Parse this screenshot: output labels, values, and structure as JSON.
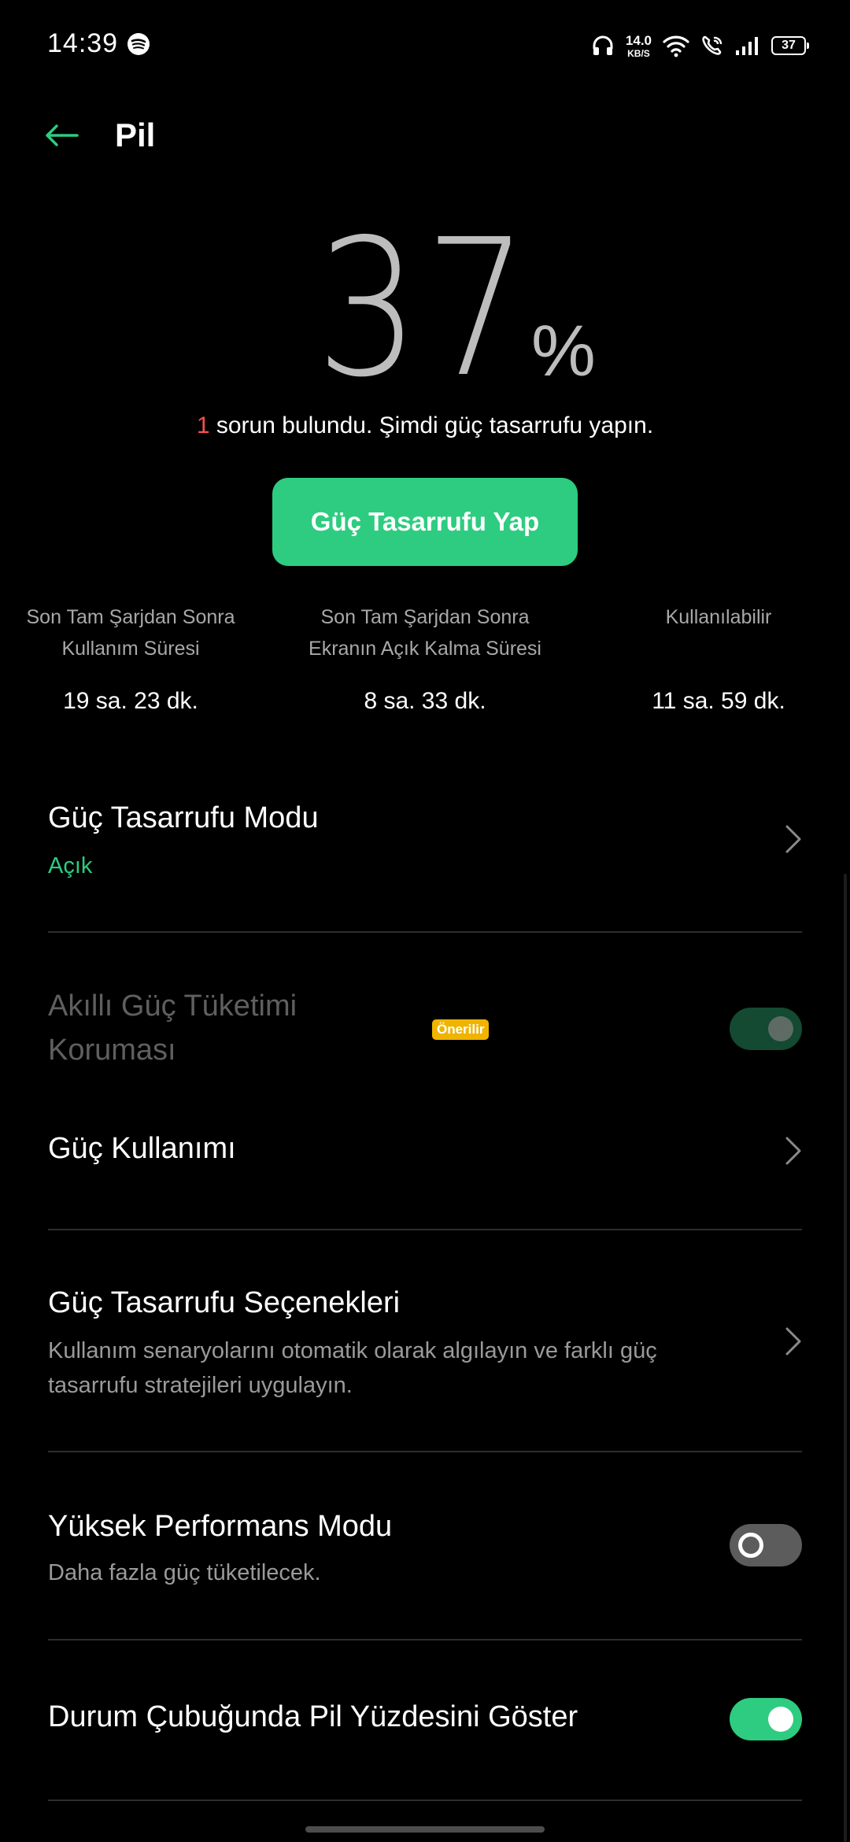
{
  "status_bar": {
    "time": "14:39",
    "net_speed_value": "14.0",
    "net_speed_unit": "KB/S",
    "battery_level": "37"
  },
  "app_bar": {
    "title": "Pil"
  },
  "battery": {
    "percent": "37",
    "unit": "%",
    "issue_count": "1",
    "issue_text": " sorun bulundu. Şimdi güç tasarrufu yapın."
  },
  "save_button_label": "Güç Tasarrufu Yap",
  "stats": [
    {
      "label_line1": "Son Tam Şarjdan Sonra",
      "label_line2": "Kullanım Süresi",
      "value": "19 sa. 23 dk."
    },
    {
      "label_line1": "Son Tam Şarjdan Sonra",
      "label_line2": "Ekranın Açık Kalma Süresi",
      "value": "8 sa. 33 dk."
    },
    {
      "label_line1": "Kullanılabilir",
      "label_line2": "",
      "value": "11 sa. 59 dk."
    }
  ],
  "settings": {
    "power_saving_mode": {
      "title": "Güç Tasarrufu Modu",
      "status": "Açık"
    },
    "smart_protection": {
      "title_line1": "Akıllı Güç Tüketimi",
      "title_line2": "Koruması",
      "badge": "Önerilir",
      "enabled": true
    },
    "power_usage": {
      "title": "Güç Kullanımı"
    },
    "power_saving_options": {
      "title": "Güç Tasarrufu Seçenekleri",
      "desc_line1": "Kullanım senaryolarını otomatik olarak algılayın ve farklı güç",
      "desc_line2": "tasarrufu stratejileri uygulayın."
    },
    "high_performance": {
      "title": "Yüksek Performans Modu",
      "desc": "Daha fazla güç tüketilecek.",
      "enabled": false
    },
    "show_percentage": {
      "title": "Durum Çubuğunda Pil Yüzdesini Göster",
      "enabled": true
    }
  },
  "colors": {
    "accent": "#2ecc80",
    "issue": "#ff4d4f",
    "badge": "#f0b400",
    "background": "#000000"
  },
  "icons": {
    "back": "arrow-left-icon",
    "chevron": "chevron-right-icon",
    "spotify": "spotify-icon",
    "headphones": "headphones-icon",
    "wifi": "wifi-icon",
    "wifi_call": "wifi-call-icon",
    "signal": "signal-icon",
    "battery": "battery-icon"
  }
}
